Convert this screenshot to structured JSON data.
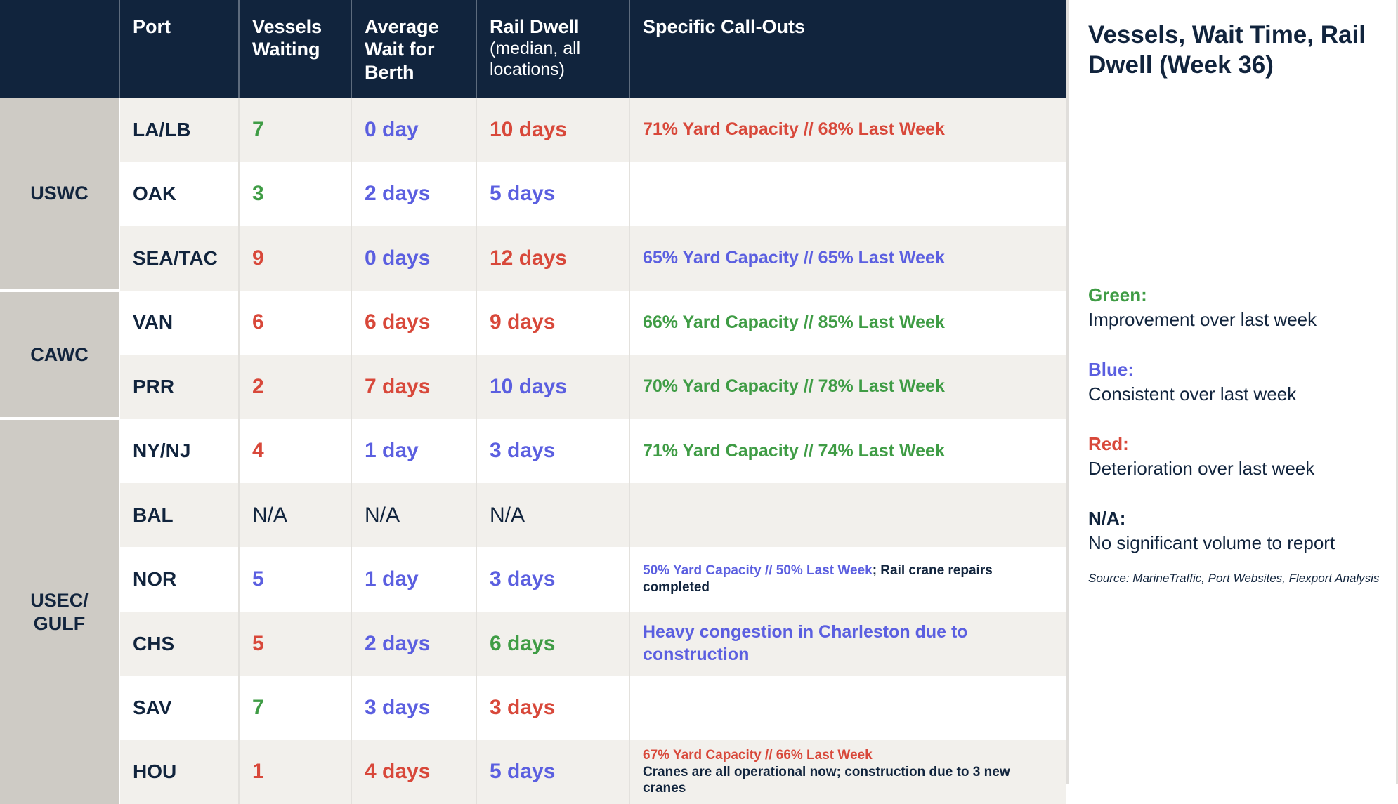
{
  "colors": {
    "header_bg": "#11243d",
    "group_bg": "#cecbc5",
    "row_alt": "#f2f0ec",
    "green": "#3f9c45",
    "blue": "#5b5fe0",
    "red": "#d8483a",
    "navy": "#11243d"
  },
  "table": {
    "headers": {
      "group": "",
      "port": "Port",
      "vessels_waiting": "Vessels Waiting",
      "average_wait": "Average Wait for Berth",
      "rail_dwell_main": "Rail Dwell",
      "rail_dwell_sub": "(median, all locations)",
      "callouts": "Specific Call-Outs"
    },
    "groups": [
      {
        "label": "USWC",
        "rows": 3
      },
      {
        "label": "CAWC",
        "rows": 2
      },
      {
        "label": "USEC/ GULF",
        "rows": 6
      }
    ],
    "rows": [
      {
        "port": "LA/LB",
        "vessels_waiting": "7",
        "vessels_color": "green",
        "average_wait": "0 day",
        "wait_color": "blue",
        "rail_dwell": "10 days",
        "dwell_color": "red",
        "callout": [
          {
            "text": "71% Yard Capacity // 68% Last Week",
            "color": "red",
            "size": "big"
          }
        ]
      },
      {
        "port": "OAK",
        "vessels_waiting": "3",
        "vessels_color": "green",
        "average_wait": "2 days",
        "wait_color": "blue",
        "rail_dwell": "5 days",
        "dwell_color": "blue",
        "callout": []
      },
      {
        "port": "SEA/TAC",
        "vessels_waiting": "9",
        "vessels_color": "red",
        "average_wait": "0 days",
        "wait_color": "blue",
        "rail_dwell": "12 days",
        "dwell_color": "red",
        "callout": [
          {
            "text": "65% Yard Capacity // 65% Last Week",
            "color": "blue",
            "size": "big"
          }
        ]
      },
      {
        "port": "VAN",
        "vessels_waiting": "6",
        "vessels_color": "red",
        "average_wait": "6 days",
        "wait_color": "red",
        "rail_dwell": "9 days",
        "dwell_color": "red",
        "callout": [
          {
            "text": "66% Yard Capacity // 85% Last Week",
            "color": "green",
            "size": "big"
          }
        ]
      },
      {
        "port": "PRR",
        "vessels_waiting": "2",
        "vessels_color": "red",
        "average_wait": "7 days",
        "wait_color": "red",
        "rail_dwell": "10 days",
        "dwell_color": "blue",
        "callout": [
          {
            "text": "70% Yard Capacity // 78% Last Week",
            "color": "green",
            "size": "big"
          }
        ]
      },
      {
        "port": "NY/NJ",
        "vessels_waiting": "4",
        "vessels_color": "red",
        "average_wait": "1 day",
        "wait_color": "blue",
        "rail_dwell": "3 days",
        "dwell_color": "blue",
        "callout": [
          {
            "text": "71% Yard Capacity // 74% Last Week",
            "color": "green",
            "size": "big"
          }
        ]
      },
      {
        "port": "BAL",
        "vessels_waiting": "N/A",
        "vessels_color": "navy",
        "average_wait": "N/A",
        "wait_color": "navy",
        "rail_dwell": "N/A",
        "dwell_color": "navy",
        "callout": []
      },
      {
        "port": "NOR",
        "vessels_waiting": "5",
        "vessels_color": "blue",
        "average_wait": "1 day",
        "wait_color": "blue",
        "rail_dwell": "3 days",
        "dwell_color": "blue",
        "callout": [
          {
            "text": "50% Yard Capacity // 50% Last Week",
            "color": "blue",
            "size": "small",
            "inline": true
          },
          {
            "text": "; Rail crane repairs completed",
            "color": "navy",
            "size": "small",
            "inline": true
          }
        ]
      },
      {
        "port": "CHS",
        "vessels_waiting": "5",
        "vessels_color": "red",
        "average_wait": "2 days",
        "wait_color": "blue",
        "rail_dwell": "6 days",
        "dwell_color": "green",
        "callout": [
          {
            "text": "Heavy congestion in Charleston due to construction",
            "color": "blue",
            "size": "big"
          }
        ]
      },
      {
        "port": "SAV",
        "vessels_waiting": "7",
        "vessels_color": "green",
        "average_wait": "3 days",
        "wait_color": "blue",
        "rail_dwell": "3 days",
        "dwell_color": "red",
        "callout": []
      },
      {
        "port": "HOU",
        "vessels_waiting": "1",
        "vessels_color": "red",
        "average_wait": "4 days",
        "wait_color": "red",
        "rail_dwell": "5 days",
        "dwell_color": "blue",
        "callout": [
          {
            "text": "67% Yard Capacity // 66% Last Week",
            "color": "red",
            "size": "small"
          },
          {
            "text": "Cranes are all operational now; construction due to 3 new cranes",
            "color": "navy",
            "size": "small"
          }
        ]
      }
    ]
  },
  "side_panel": {
    "title": "Vessels, Wait Time, Rail Dwell (Week 36)",
    "legend": [
      {
        "key": "Green:",
        "key_color": "green",
        "desc": "Improvement over last week"
      },
      {
        "key": "Blue:",
        "key_color": "blue",
        "desc": "Consistent over last week"
      },
      {
        "key": "Red:",
        "key_color": "red",
        "desc": "Deterioration over last week"
      },
      {
        "key": "N/A:",
        "key_color": "navy",
        "desc": "No significant volume to report"
      }
    ],
    "source": "Source: MarineTraffic, Port Websites, Flexport Analysis"
  }
}
